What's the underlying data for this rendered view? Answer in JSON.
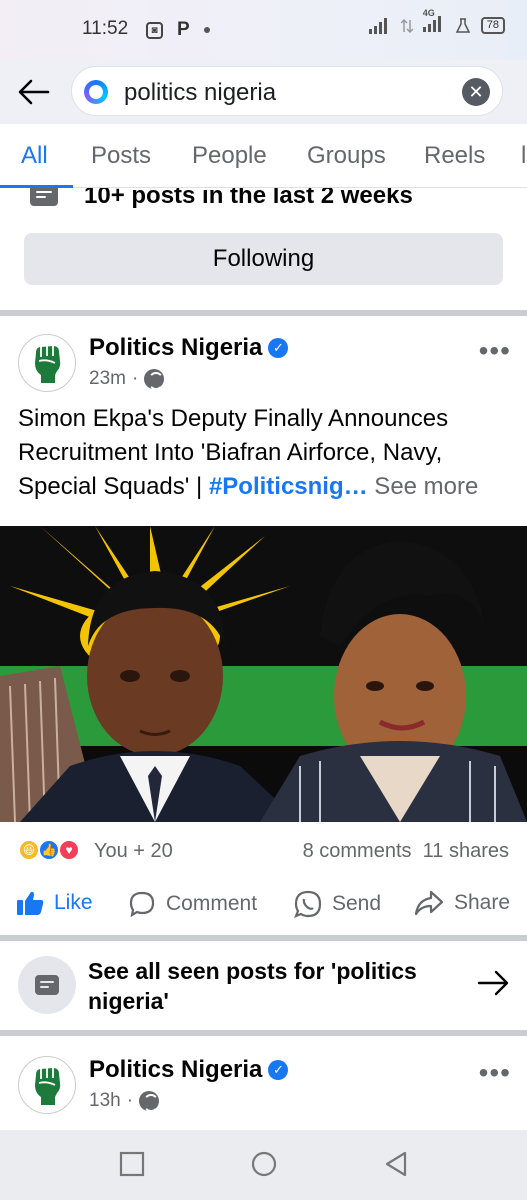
{
  "status_bar": {
    "time": "11:52",
    "network": "4G",
    "battery": "78"
  },
  "search": {
    "query": "politics nigeria"
  },
  "tabs": [
    {
      "label": "All",
      "active": true
    },
    {
      "label": "Posts",
      "active": false
    },
    {
      "label": "People",
      "active": false
    },
    {
      "label": "Groups",
      "active": false
    },
    {
      "label": "Reels",
      "active": false
    }
  ],
  "page_info": {
    "recent_posts": "10+ posts in the last 2 weeks",
    "following_label": "Following"
  },
  "post1": {
    "page_name": "Politics Nigeria",
    "time": "23m",
    "caption": "Simon Ekpa's Deputy Finally Announces Recruitment Into 'Biafran Airforce, Navy, Special Squads' | ",
    "hashtag": "#Politicsnig…",
    "see_more": " See more",
    "reactions_label": "You + 20",
    "comments": "8 comments",
    "shares": "11 shares",
    "actions": {
      "like": "Like",
      "comment": "Comment",
      "send": "Send",
      "share": "Share"
    }
  },
  "seen_posts": {
    "label": "See all seen posts for 'politics nigeria'"
  },
  "post2": {
    "page_name": "Politics Nigeria",
    "time": "13h"
  },
  "colors": {
    "accent": "#1877f2",
    "secondary_text": "#65676b",
    "button_bg": "#e4e6eb",
    "fist_green": "#1c7a3a"
  }
}
